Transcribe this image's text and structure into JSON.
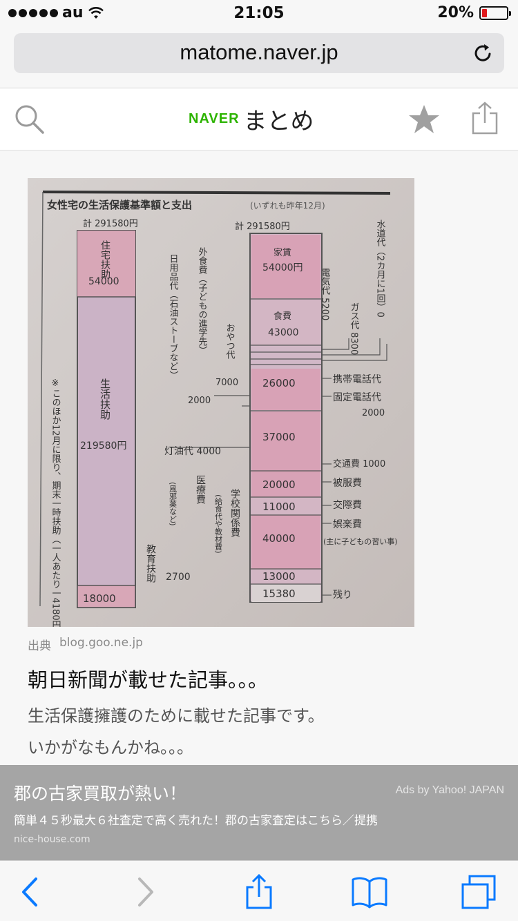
{
  "status_bar": {
    "carrier": "au",
    "time": "21:05",
    "battery_percent": "20%",
    "battery_level": 0.2,
    "signal_bars": 5
  },
  "browser": {
    "url": "matome.naver.jp"
  },
  "header": {
    "logo_brand": "NAVER",
    "logo_title": "まとめ"
  },
  "content": {
    "image_description_name": "newspaper-clipping-photo",
    "source_label": "出典",
    "source_domain": "blog.goo.ne.jp",
    "headline": "朝日新聞が載せた記事。。。",
    "description_lines": [
      "生活保護擁護のために載せた記事です。",
      "いかがなもんかね。。。"
    ]
  },
  "clipping": {
    "title": "女性宅の生活保護基準額と支出",
    "title_note": "(いずれも昨年12月)",
    "left_total": "計 291580円",
    "right_total": "計 291580円",
    "left_blocks": [
      {
        "label": "住宅扶助",
        "amount": "54000"
      },
      {
        "label": "生活扶助",
        "amount": "219580円"
      },
      {
        "label": "",
        "amount": "18000"
      }
    ],
    "left_vertical_note": "※このほか12月に限り、期末一時扶助（一人あたり一4180円）がある",
    "education_label": "教育扶助",
    "right_blocks": [
      {
        "label": "家賃",
        "amount": "54000円"
      },
      {
        "label": "食費",
        "amount": "43000"
      },
      {
        "label": "",
        "amount": "26000"
      },
      {
        "label": "",
        "amount": "37000"
      },
      {
        "label": "",
        "amount": "20000"
      },
      {
        "label": "",
        "amount": "11000"
      },
      {
        "label": "",
        "amount": "40000"
      },
      {
        "label": "",
        "amount": "13000"
      },
      {
        "label": "",
        "amount": "15380"
      }
    ],
    "side_labels": {
      "water": "水道代（2カ月に1回）0",
      "electric": "電気代 5200",
      "gas": "ガス代 8300",
      "eating_out": "外食費（子どもの進学先）",
      "snacks": "おやつ代",
      "snacks_amount": "7000",
      "daily_goods": "日用品代（石油ストーブなど）",
      "daily_amount": "2000",
      "mobile": "携帯電話代",
      "landline": "固定電話代",
      "landline_amount": "2000",
      "kerosene": "灯油代 4000",
      "transport": "交通費 1000",
      "clothes": "被服費",
      "social": "交際費",
      "entertainment": "娯楽費",
      "entertainment_note": "(主に子どもの習い事)",
      "medical": "医療費",
      "medical_note": "(風邪薬など)",
      "medical_amount": "2700",
      "school": "学校関係費",
      "school_note": "(給食代や教材費)",
      "remainder": "残り"
    }
  },
  "ad": {
    "title": "郡の古家買取が熱い！",
    "provider": "Ads by Yahoo! JAPAN",
    "text": "簡単４５秒最大６社査定で高く売れた！郡の古家査定はこちら／提携",
    "domain": "nice-house.com"
  },
  "colors": {
    "naver_green": "#2db400",
    "ios_blue": "#0a7aff",
    "battery_red": "#e0191c",
    "ad_bg": "#a5a5a5"
  }
}
